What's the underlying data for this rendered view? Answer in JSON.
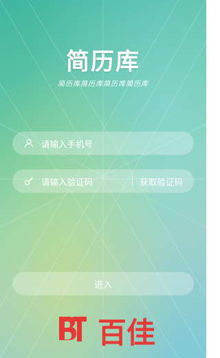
{
  "app": {
    "logo_text": "简历库",
    "slogan": "简历库简历库简历库简历库"
  },
  "login": {
    "phone_placeholder": "请输入手机号",
    "code_placeholder": "请输入验证码",
    "get_code_label": "获取验证码",
    "enter_label": "进入"
  },
  "icons": {
    "phone_field_icon": "user-icon",
    "code_field_icon": "key-icon"
  },
  "watermark": {
    "text": "百佳",
    "mark": "BT",
    "color": "#e53935"
  },
  "colors": {
    "bg_start": "#3fb6a0",
    "bg_end": "#7ec9d8",
    "text": "#ffffff"
  }
}
